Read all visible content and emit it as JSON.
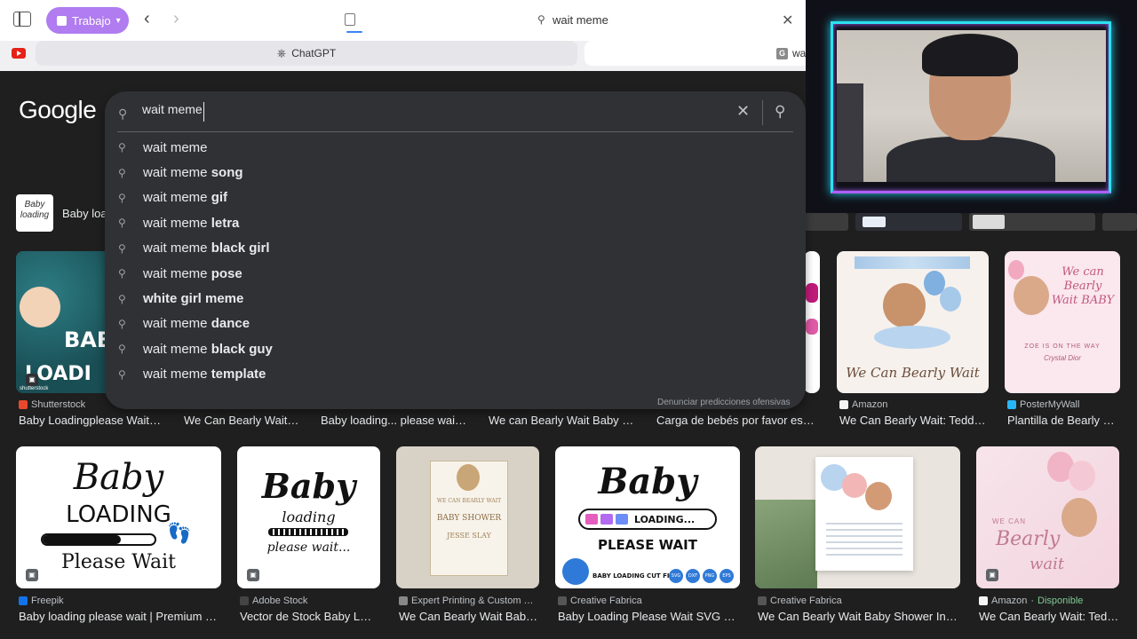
{
  "browser": {
    "profile_label": "Trabajo",
    "address_text": "wait meme",
    "tabs": [
      {
        "label": "ChatGPT"
      },
      {
        "label": "wa"
      }
    ]
  },
  "google": {
    "logo_text": "Google",
    "related_chip_label": "Baby loa",
    "related_chip_thumb_text": "Baby loading",
    "search": {
      "value": "wait meme"
    },
    "suggestions": [
      {
        "prefix": "wait meme",
        "suffix": ""
      },
      {
        "prefix": "wait meme ",
        "suffix": "song"
      },
      {
        "prefix": "wait meme ",
        "suffix": "gif"
      },
      {
        "prefix": "wait meme ",
        "suffix": "letra"
      },
      {
        "prefix": "wait meme ",
        "suffix": "black girl"
      },
      {
        "prefix": "wait meme ",
        "suffix": "pose"
      },
      {
        "prefix": "",
        "suffix": "white girl meme"
      },
      {
        "prefix": "wait meme ",
        "suffix": "dance"
      },
      {
        "prefix": "wait meme ",
        "suffix": "black guy"
      },
      {
        "prefix": "wait meme ",
        "suffix": "template"
      }
    ],
    "report_link": "Denunciar predicciones ofensivas"
  },
  "results_row1": [
    {
      "source": "Shutterstock",
      "caption": "Baby Loadingplease Wait…",
      "thumb_text": "BABY LOADIN",
      "watermark": "shutterstock",
      "color": "#e8492c"
    },
    {
      "source": "",
      "caption": "We Can Bearly Wait…"
    },
    {
      "source": "",
      "caption": "Baby loading... please wai…"
    },
    {
      "source": "",
      "caption": "We can Bearly Wait Baby …"
    },
    {
      "source": "",
      "caption": "Carga de bebés por favor es…"
    },
    {
      "source": "Amazon",
      "caption": "We Can Bearly Wait: Tedd…",
      "thumb_text": "We Can Bearly Wait",
      "color": "#ff9900"
    },
    {
      "source": "PosterMyWall",
      "caption": "Plantilla de Bearly …",
      "thumb_text": "We can Bearly Wait BABY",
      "sub_text": "ZOE IS ON THE WAY",
      "name_text": "Crystal Dior",
      "color": "#29b6f6"
    }
  ],
  "results_row2": [
    {
      "source": "Freepik",
      "caption": "Baby loading please wait | Premium …",
      "line1": "Baby",
      "line2": "LOADING",
      "line3": "Please Wait",
      "color": "#1273eb"
    },
    {
      "source": "Adobe Stock",
      "caption": "Vector de Stock Baby L…",
      "line1": "Baby",
      "line2": "loading",
      "line3": "please wait...",
      "color": "#444444"
    },
    {
      "source": "Expert Printing & Custom …",
      "caption": "We Can Bearly Wait Bab…",
      "line1": "WE CAN BEARLY WAIT",
      "line2": "BABY SHOWER",
      "line3": "JESSE SLAY",
      "color": "#888888"
    },
    {
      "source": "Creative Fabrica",
      "caption": "Baby Loading Please Wait SVG …",
      "line1": "Baby",
      "line2": "LOADING...",
      "line3": "PLEASE WAIT",
      "badge": "BABY LOADING CUT FILE",
      "formats": [
        "SVG",
        "DXF",
        "PNG",
        "EPS"
      ],
      "color": "#555555"
    },
    {
      "source": "Creative Fabrica",
      "caption": "We Can Bearly Wait Baby Shower In…",
      "color": "#555555"
    },
    {
      "source": "Amazon",
      "availability": "Disponible",
      "caption": "We Can Bearly Wait: Ted…",
      "line1": "WE CAN",
      "line2": "Bearly",
      "line3": "wait",
      "color": "#ff9900"
    }
  ]
}
